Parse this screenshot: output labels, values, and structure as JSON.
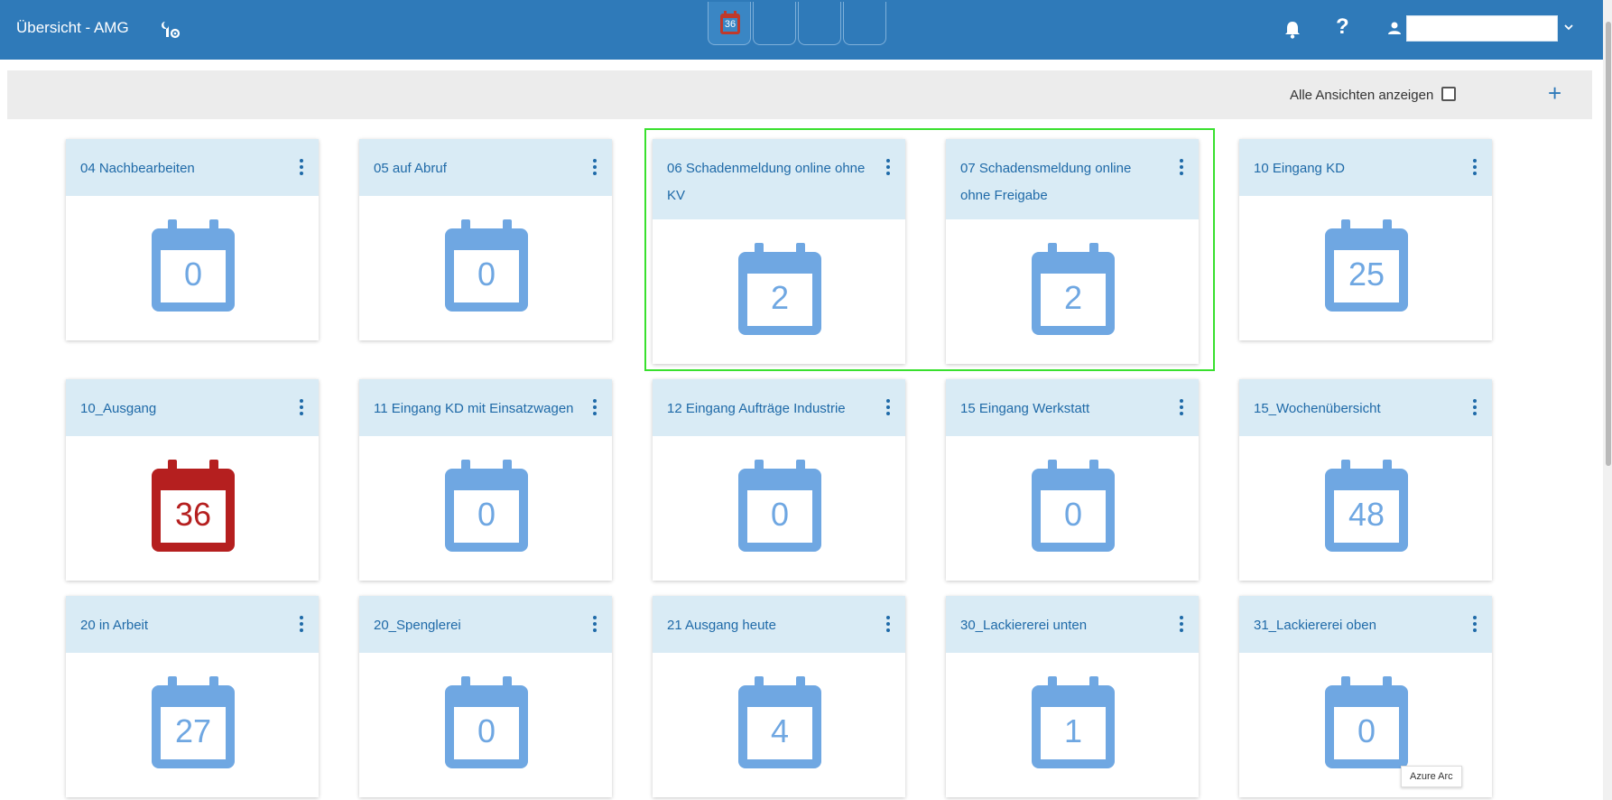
{
  "header": {
    "title": "Übersicht - AMG",
    "tab_badge": "36",
    "user_value": ""
  },
  "toolbar": {
    "all_views_label": "Alle Ansichten anzeigen",
    "all_views_checked": false,
    "add_label": "+"
  },
  "colors": {
    "header": "#2f7ab9",
    "card_head": "#d9ebf5",
    "calendar": "#6fa7e2",
    "calendar_alert": "#b51f1f",
    "highlight": "#39e02e"
  },
  "cards": [
    {
      "title": "04 Nachbearbeiten",
      "count": "0",
      "alert": false
    },
    {
      "title": "05 auf Abruf",
      "count": "0",
      "alert": false
    },
    {
      "title": "06 Schadenmeldung online ohne KV",
      "count": "2",
      "alert": false
    },
    {
      "title": "07 Schadensmeldung online ohne Freigabe",
      "count": "2",
      "alert": false
    },
    {
      "title": "10 Eingang KD",
      "count": "25",
      "alert": false
    },
    {
      "title": "10_Ausgang",
      "count": "36",
      "alert": true
    },
    {
      "title": "11 Eingang KD mit Einsatzwagen",
      "count": "0",
      "alert": false
    },
    {
      "title": "12 Eingang Aufträge Industrie",
      "count": "0",
      "alert": false
    },
    {
      "title": "15 Eingang Werkstatt",
      "count": "0",
      "alert": false
    },
    {
      "title": "15_Wochenübersicht",
      "count": "48",
      "alert": false
    },
    {
      "title": "20 in Arbeit",
      "count": "27",
      "alert": false
    },
    {
      "title": "20_Spenglerei",
      "count": "0",
      "alert": false
    },
    {
      "title": "21 Ausgang heute",
      "count": "4",
      "alert": false
    },
    {
      "title": "30_Lackiererei unten",
      "count": "1",
      "alert": false
    },
    {
      "title": "31_Lackiererei oben",
      "count": "0",
      "alert": false
    }
  ],
  "tooltip": "Azure Arc"
}
